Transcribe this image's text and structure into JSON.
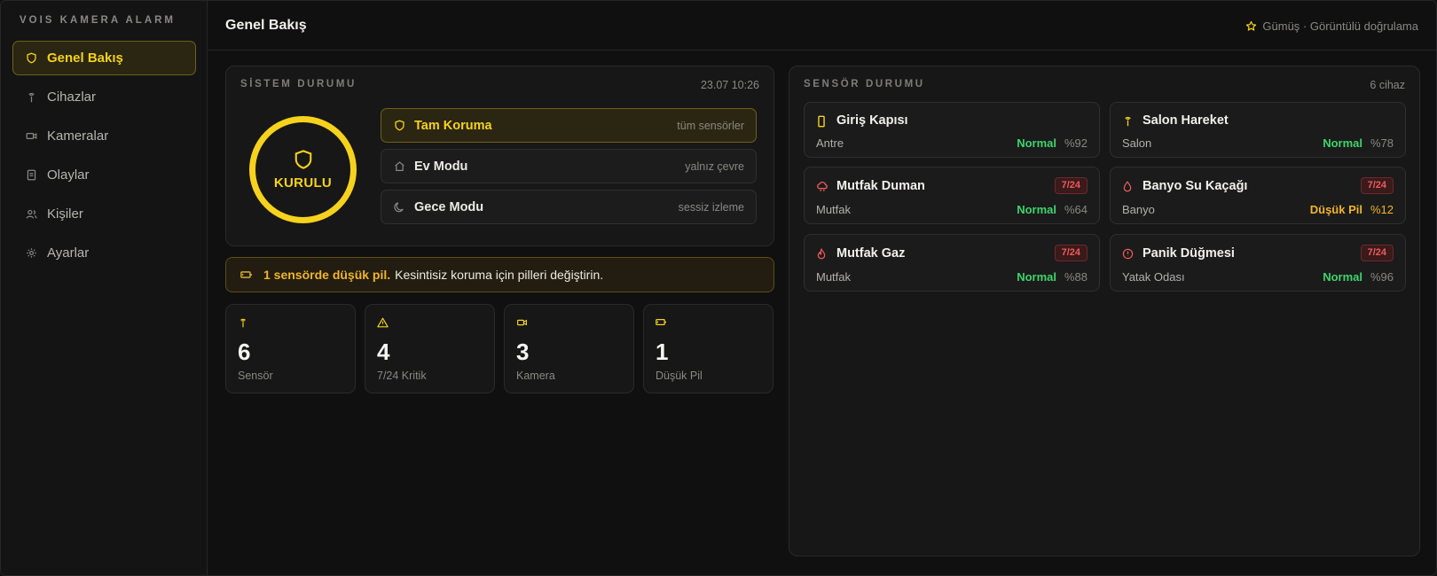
{
  "brand": "VOIS KAMERA ALARM",
  "nav": [
    {
      "label": "Genel Bakış",
      "icon": "shield-icon",
      "active": true
    },
    {
      "label": "Cihazlar",
      "icon": "antenna-icon"
    },
    {
      "label": "Kameralar",
      "icon": "camera-icon"
    },
    {
      "label": "Olaylar",
      "icon": "document-icon"
    },
    {
      "label": "Kişiler",
      "icon": "users-icon"
    },
    {
      "label": "Ayarlar",
      "icon": "gear-icon"
    }
  ],
  "header": {
    "title": "Genel Bakış",
    "tier": "Gümüş · Görüntülü doğrulama",
    "tier_icon": "star-icon"
  },
  "system": {
    "title": "SİSTEM DURUMU",
    "time": "23.07 10:26",
    "state": "KURULU",
    "modes": [
      {
        "name": "Tam Koruma",
        "hint": "tüm sensörler",
        "icon": "shield-icon",
        "active": true
      },
      {
        "name": "Ev Modu",
        "hint": "yalnız çevre",
        "icon": "home-icon"
      },
      {
        "name": "Gece Modu",
        "hint": "sessiz izleme",
        "icon": "moon-icon"
      }
    ]
  },
  "alert": {
    "strong": "1 sensörde düşük pil.",
    "text": "Kesintisiz koruma için pilleri değiştirin.",
    "icon": "battery-icon"
  },
  "stats": [
    {
      "value": "6",
      "label": "Sensör",
      "icon": "antenna-icon"
    },
    {
      "value": "4",
      "label": "7/24 Kritik",
      "icon": "warning-icon"
    },
    {
      "value": "3",
      "label": "Kamera",
      "icon": "camera-icon"
    },
    {
      "value": "1",
      "label": "Düşük Pil",
      "icon": "battery-icon"
    }
  ],
  "sensors": {
    "title": "SENSÖR DURUMU",
    "count": "6 cihaz",
    "items": [
      {
        "name": "Giriş Kapısı",
        "location": "Antre",
        "status": "Normal",
        "battery": "%92",
        "icon": "door-icon",
        "badge": ""
      },
      {
        "name": "Salon Hareket",
        "location": "Salon",
        "status": "Normal",
        "battery": "%78",
        "icon": "antenna-icon",
        "badge": ""
      },
      {
        "name": "Mutfak Duman",
        "location": "Mutfak",
        "status": "Normal",
        "battery": "%64",
        "icon": "cloud-icon",
        "badge": "7/24"
      },
      {
        "name": "Banyo Su Kaçağı",
        "location": "Banyo",
        "status": "Düşük Pil",
        "battery": "%12",
        "icon": "droplet-icon",
        "badge": "7/24"
      },
      {
        "name": "Mutfak Gaz",
        "location": "Mutfak",
        "status": "Normal",
        "battery": "%88",
        "icon": "flame-icon",
        "badge": "7/24"
      },
      {
        "name": "Panik Düğmesi",
        "location": "Yatak Odası",
        "status": "Normal",
        "battery": "%96",
        "icon": "alert-circle-icon",
        "badge": "7/24"
      }
    ]
  },
  "colors": {
    "accent": "#f6d21c",
    "ok": "#3fd46b",
    "warn": "#f2b52a",
    "critical": "#ef5b5b"
  }
}
